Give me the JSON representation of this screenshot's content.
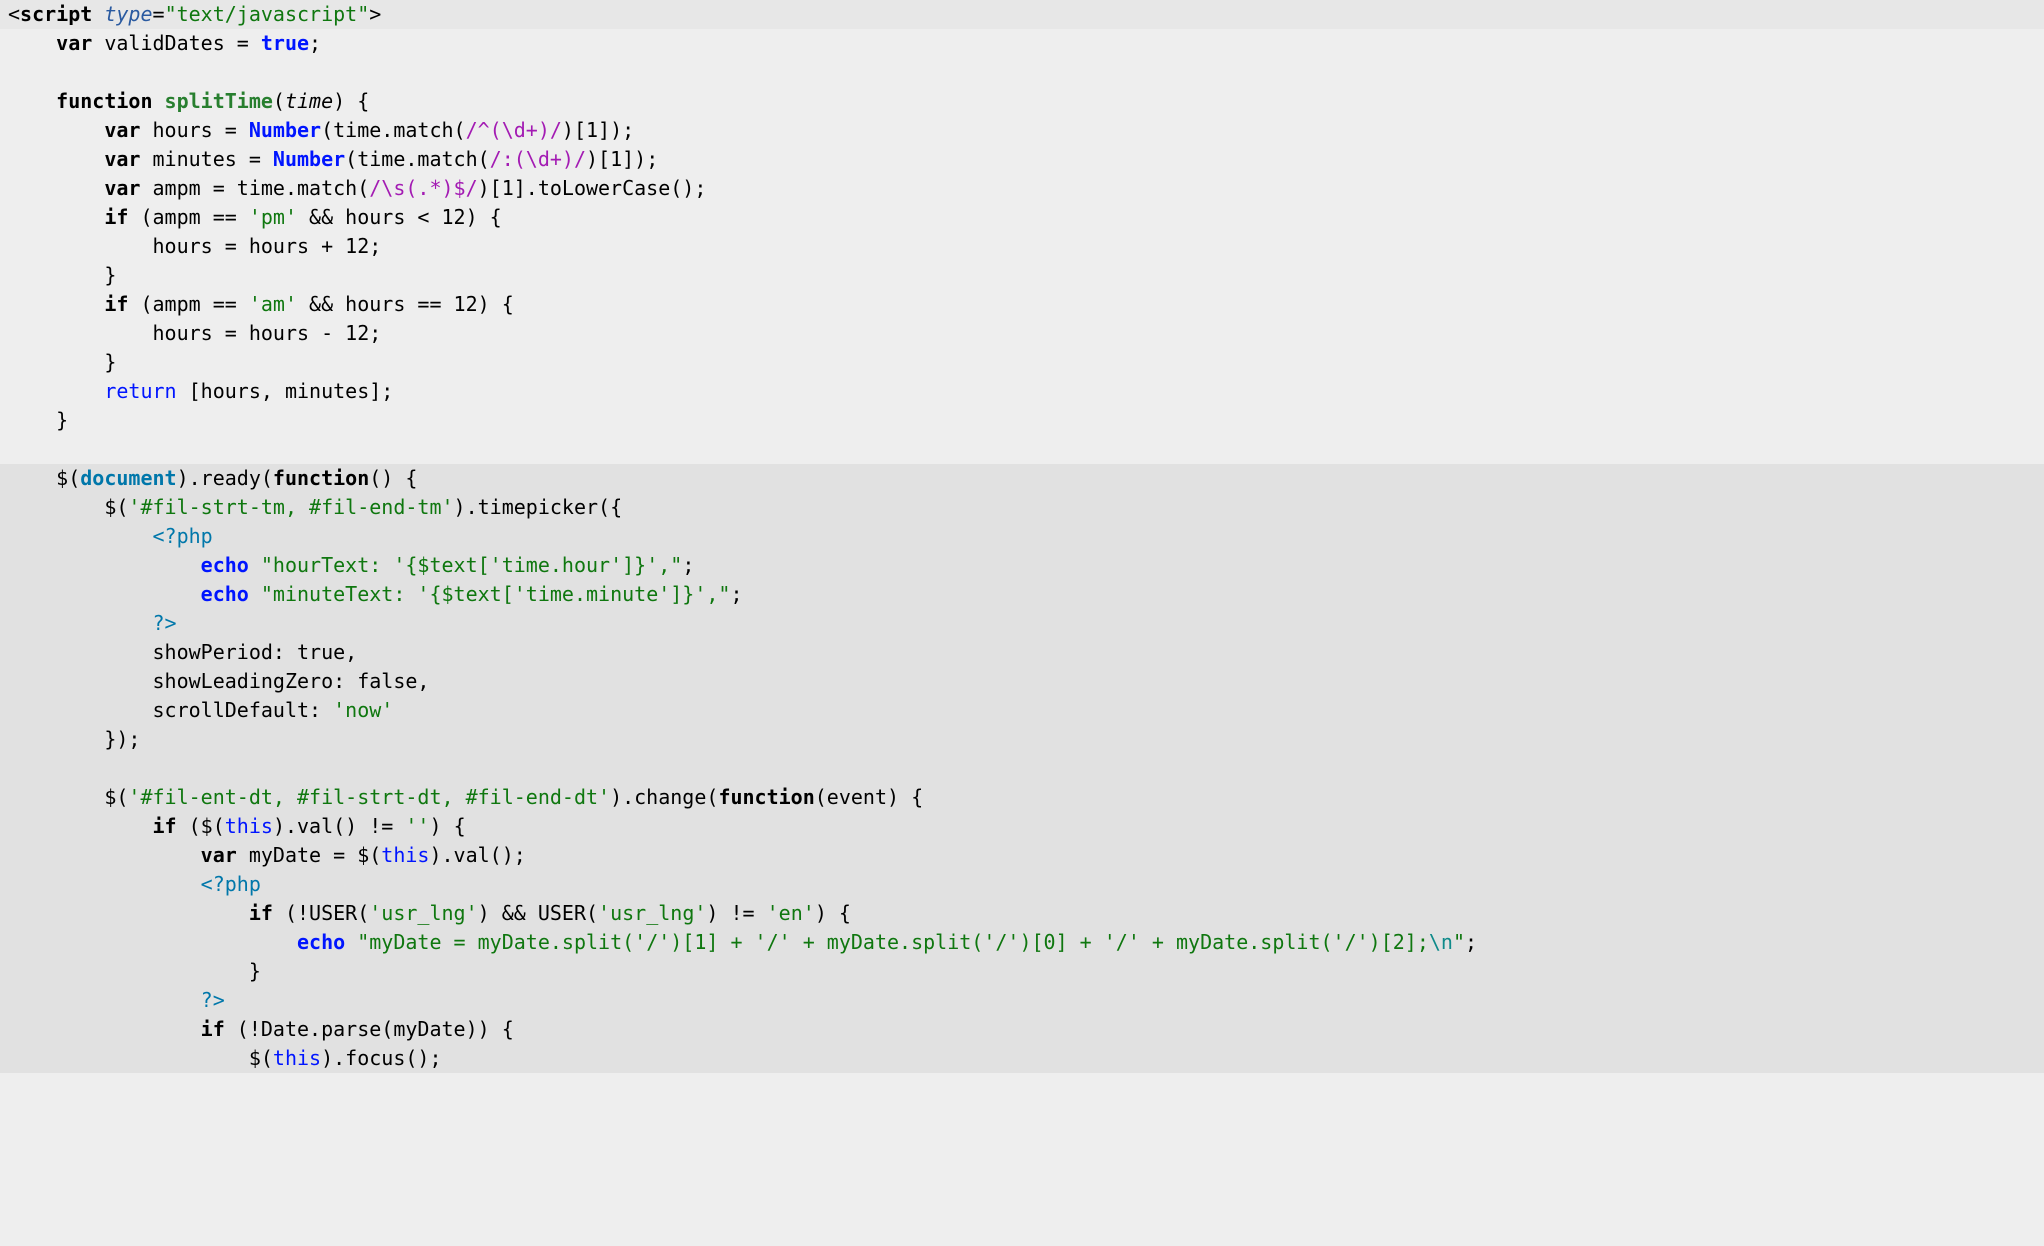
{
  "lines": [
    {
      "cls": "hl",
      "html": "<span class='op'>&lt;</span><span class='tag'>script</span> <span class='attr'>type</span>=<span class='str'>\"text/javascript\"</span><span class='op'>&gt;</span>"
    },
    {
      "cls": "",
      "html": "    <span class='kw'>var</span> validDates = <span class='blue'>true</span>;"
    },
    {
      "cls": "",
      "html": ""
    },
    {
      "cls": "",
      "html": "    <span class='kw'>function</span> <span class='fn'>splitTime</span>(<span class='it'>time</span>) {"
    },
    {
      "cls": "",
      "html": "        <span class='kw'>var</span> hours = <span class='blue'>Number</span>(time.match(<span class='purple'>/^(\\d+)/</span>)[1]);"
    },
    {
      "cls": "",
      "html": "        <span class='kw'>var</span> minutes = <span class='blue'>Number</span>(time.match(<span class='purple'>/:(\\d+)/</span>)[1]);"
    },
    {
      "cls": "",
      "html": "        <span class='kw'>var</span> ampm = time.match(<span class='purple'>/\\s(.*)$/</span>)[1].toLowerCase();"
    },
    {
      "cls": "",
      "html": "        <span class='kw'>if</span> (ampm == <span class='str'>'pm'</span> &amp;&amp; hours &lt; 12) {"
    },
    {
      "cls": "",
      "html": "            hours = hours + 12;"
    },
    {
      "cls": "",
      "html": "        }"
    },
    {
      "cls": "",
      "html": "        <span class='kw'>if</span> (ampm == <span class='str'>'am'</span> &amp;&amp; hours == 12) {"
    },
    {
      "cls": "",
      "html": "            hours = hours - 12;"
    },
    {
      "cls": "",
      "html": "        }"
    },
    {
      "cls": "",
      "html": "        <span class='blueN'>return</span> [hours, minutes];"
    },
    {
      "cls": "",
      "html": "    }"
    },
    {
      "cls": "",
      "html": ""
    },
    {
      "cls": "bg2",
      "html": "    $(<span class='id'>document</span>).ready(<span class='kw'>function</span>() {"
    },
    {
      "cls": "bg2",
      "html": "        $(<span class='str'>'#fil-strt-tm, #fil-end-tm'</span>).timepicker({"
    },
    {
      "cls": "bg2",
      "html": "            <span class='ident'>&lt;?php</span>"
    },
    {
      "cls": "bg2",
      "html": "                <span class='blue'>echo</span> <span class='str'>\"hourText: '{$text['time.hour']}',\"</span>;"
    },
    {
      "cls": "bg2",
      "html": "                <span class='blue'>echo</span> <span class='str'>\"minuteText: '{$text['time.minute']}',\"</span>;"
    },
    {
      "cls": "bg2",
      "html": "            <span class='ident'>?&gt;</span>"
    },
    {
      "cls": "bg2",
      "html": "            showPeriod: true,"
    },
    {
      "cls": "bg2",
      "html": "            showLeadingZero: false,"
    },
    {
      "cls": "bg2",
      "html": "            scrollDefault: <span class='str'>'now'</span>"
    },
    {
      "cls": "bg2",
      "html": "        });"
    },
    {
      "cls": "bg2",
      "html": ""
    },
    {
      "cls": "bg2",
      "html": "        $(<span class='str'>'#fil-ent-dt, #fil-strt-dt, #fil-end-dt'</span>).change(<span class='kw'>function</span>(event) {"
    },
    {
      "cls": "bg2",
      "html": "            <span class='kw'>if</span> ($(<span class='blueN'>this</span>).val() != <span class='str'>''</span>) {"
    },
    {
      "cls": "bg2",
      "html": "                <span class='kw'>var</span> myDate = $(<span class='blueN'>this</span>).val();"
    },
    {
      "cls": "bg2",
      "html": "                <span class='ident'>&lt;?php</span>"
    },
    {
      "cls": "bg2",
      "html": "                    <span class='kw'>if</span> (!USER(<span class='str'>'usr_lng'</span>) &amp;&amp; USER(<span class='str'>'usr_lng'</span>) != <span class='str'>'en'</span>) {"
    },
    {
      "cls": "bg2",
      "html": "                        <span class='blue'>echo</span> <span class='str'>\"myDate = myDate.split('/')[1] + '/' + myDate.split('/')[0] + '/' + myDate.split('/')[2];</span><span class='esc'>\\n</span><span class='str'>\"</span>;"
    },
    {
      "cls": "bg2",
      "html": "                    }"
    },
    {
      "cls": "bg2",
      "html": "                <span class='ident'>?&gt;</span>"
    },
    {
      "cls": "bg2",
      "html": "                <span class='kw'>if</span> (!Date.parse(myDate)) {"
    },
    {
      "cls": "bg2",
      "html": "                    $(<span class='blueN'>this</span>).focus();"
    }
  ]
}
